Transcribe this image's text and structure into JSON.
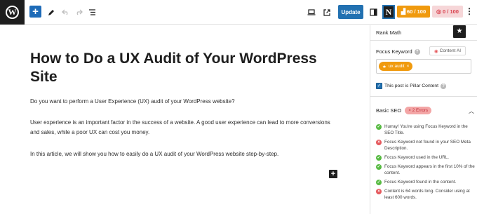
{
  "toolbar": {
    "update_label": "Update",
    "n_badge_letter": "N",
    "seo_score": "60 / 100",
    "readability_score": "0 / 100"
  },
  "editor": {
    "title": "How to Do a UX Audit of Your WordPress Site",
    "paragraphs": [
      "Do you want to perform a User Experience (UX) audit of your WordPress website?",
      "User experience is an important factor in the success of a website. A good user experience can lead to more conversions and sales, while a poor UX can cost you money.",
      "In this article, we will show you how to easily do a UX audit of your WordPress website step-by-step."
    ]
  },
  "sidebar": {
    "title": "Rank Math",
    "focus_keyword_label": "Focus Keyword",
    "content_ai_label": "Content AI",
    "keyword_tag": "ux audit",
    "pillar_label": "This post is Pillar Content",
    "basic_seo_label": "Basic SEO",
    "errors_badge": "× 2 Errors",
    "checks": [
      {
        "status": "ok",
        "text": "Hurray! You're using Focus Keyword in the SEO Title."
      },
      {
        "status": "bad",
        "text": "Focus Keyword not found in your SEO Meta Description."
      },
      {
        "status": "ok",
        "text": "Focus Keyword used in the URL."
      },
      {
        "status": "ok",
        "text": "Focus Keyword appears in the first 10% of the content."
      },
      {
        "status": "ok",
        "text": "Focus Keyword found in the content."
      },
      {
        "status": "bad",
        "text": "Content is 64 words long. Consider using at least 600 words."
      }
    ]
  },
  "colors": {
    "accent_blue": "#2271b1",
    "score_orange": "#f09a0e",
    "score_pink_bg": "#f6d6d8",
    "ok_green": "#58bb43",
    "error_red": "#e5595d"
  }
}
